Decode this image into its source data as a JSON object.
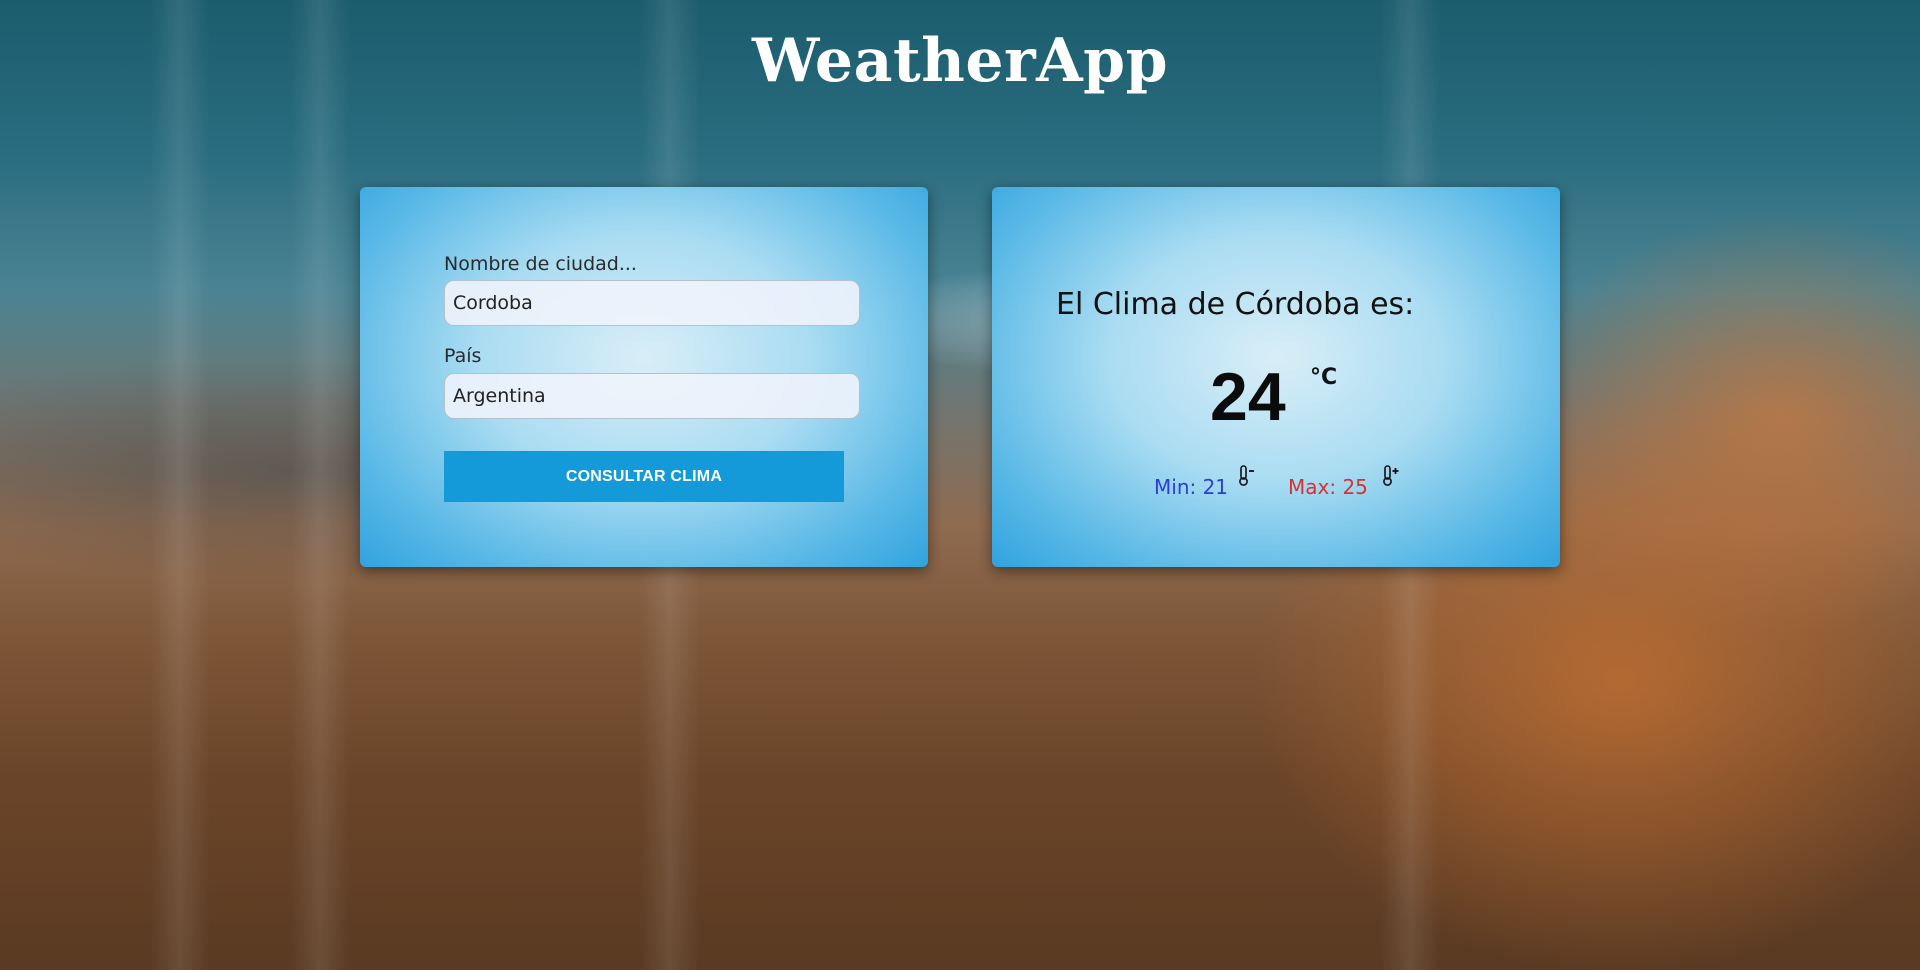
{
  "app": {
    "title": "WeatherApp"
  },
  "form": {
    "city_label": "Nombre de ciudad...",
    "city_value": "Cordoba",
    "country_label": "País",
    "country_value": "Argentina",
    "submit_label": "Consultar clima"
  },
  "result": {
    "heading": "El Clima de Córdoba es:",
    "temperature": "24",
    "unit": "°C",
    "min_text": "Min: 21",
    "max_text": "Max: 25",
    "min_icon": "thermometer-minus-icon",
    "max_icon": "thermometer-plus-icon"
  },
  "colors": {
    "button": "#149ad9",
    "min": "#2a3fd6",
    "max": "#d93030"
  }
}
